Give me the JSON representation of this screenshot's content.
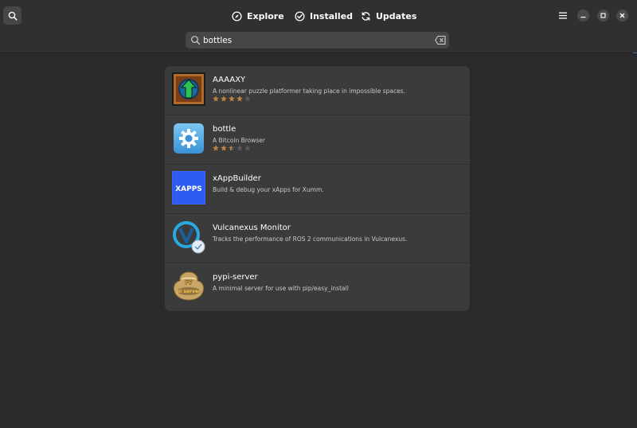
{
  "header": {
    "tabs": [
      {
        "label": "Explore",
        "icon": "compass-icon"
      },
      {
        "label": "Installed",
        "icon": "check-circle-icon"
      },
      {
        "label": "Updates",
        "icon": "refresh-icon"
      }
    ],
    "icons": [
      "search-icon",
      "hamburger-menu-icon",
      "minimize-icon",
      "maximize-icon",
      "close-icon"
    ]
  },
  "search": {
    "value": "bottles",
    "placeholder": ""
  },
  "colors": {
    "window_bg": "#2a2a2a",
    "header_bg": "#303030",
    "card_bg": "#3b3b3b",
    "star_filled": "#c08040",
    "star_empty": "#5a5a5a"
  },
  "results": [
    {
      "name": "AAAAXY",
      "description": "A nonlinear puzzle platformer taking place in impossible spaces.",
      "rating": 4,
      "icon": "aaaaxy-arrow-icon"
    },
    {
      "name": "bottle",
      "description": "A Bitcoin Browser",
      "rating": 2.5,
      "icon": "bottle-gear-icon"
    },
    {
      "name": "xAppBuilder",
      "description": "Build & debug your xApps for Xumm.",
      "rating": null,
      "icon": "xapps-logo-icon",
      "icon_text": "XAPPS"
    },
    {
      "name": "Vulcanexus Monitor",
      "description": "Tracks the performance of ROS 2 communications in Vulcanexus.",
      "rating": null,
      "icon": "vulcanexus-logo-icon"
    },
    {
      "name": "pypi-server",
      "description": "A minimal server for use with pip/easy_install",
      "rating": null,
      "icon": "pypi-server-logo-icon"
    }
  ]
}
